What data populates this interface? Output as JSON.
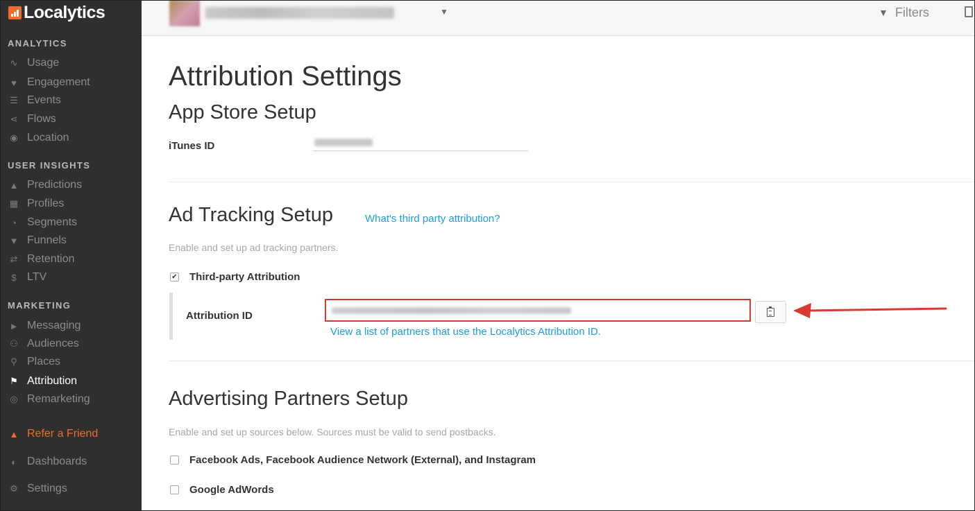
{
  "brand": {
    "name": "Localytics",
    "accent_color": "#f26b2a"
  },
  "sidebar": {
    "sections": [
      {
        "heading": "ANALYTICS",
        "items": [
          {
            "label": "Usage",
            "icon": "pulse-icon"
          },
          {
            "label": "Engagement",
            "icon": "heart-icon"
          },
          {
            "label": "Events",
            "icon": "list-icon"
          },
          {
            "label": "Flows",
            "icon": "flows-icon"
          },
          {
            "label": "Location",
            "icon": "globe-icon"
          }
        ]
      },
      {
        "heading": "USER INSIGHTS",
        "items": [
          {
            "label": "Predictions",
            "icon": "flask-icon"
          },
          {
            "label": "Profiles",
            "icon": "profile-card-icon"
          },
          {
            "label": "Segments",
            "icon": "pie-icon"
          },
          {
            "label": "Funnels",
            "icon": "funnel-icon"
          },
          {
            "label": "Retention",
            "icon": "repeat-icon"
          },
          {
            "label": "LTV",
            "icon": "dollar-icon"
          }
        ]
      },
      {
        "heading": "MARKETING",
        "items": [
          {
            "label": "Messaging",
            "icon": "megaphone-icon"
          },
          {
            "label": "Audiences",
            "icon": "users-icon"
          },
          {
            "label": "Places",
            "icon": "map-pin-icon"
          },
          {
            "label": "Attribution",
            "icon": "tag-icon",
            "active": true
          },
          {
            "label": "Remarketing",
            "icon": "target-icon"
          }
        ]
      }
    ],
    "refer": {
      "label": "Refer a Friend",
      "icon": "thumbs-up-icon"
    },
    "dashboards": {
      "label": "Dashboards",
      "icon": "gauge-icon"
    },
    "settings": {
      "label": "Settings",
      "icon": "gear-icon"
    }
  },
  "topbar": {
    "filters_label": "Filters"
  },
  "page": {
    "title": "Attribution Settings",
    "app_store": {
      "heading": "App Store Setup",
      "itunes_label": "iTunes ID"
    },
    "ad_tracking": {
      "heading": "Ad Tracking Setup",
      "help_link": "What's third party attribution?",
      "description": "Enable and set up ad tracking partners.",
      "third_party_label": "Third-party Attribution",
      "third_party_checked": true,
      "attribution_id_label": "Attribution ID",
      "partners_link": "View a list of partners that use the Localytics Attribution ID."
    },
    "advertising": {
      "heading": "Advertising Partners Setup",
      "description": "Enable and set up sources below. Sources must be valid to send postbacks.",
      "partners": [
        {
          "label": "Facebook Ads, Facebook Audience Network (External), and Instagram",
          "checked": false
        },
        {
          "label": "Google AdWords",
          "checked": false
        }
      ]
    }
  },
  "annotation": {
    "highlight_color": "#d83a2f"
  }
}
